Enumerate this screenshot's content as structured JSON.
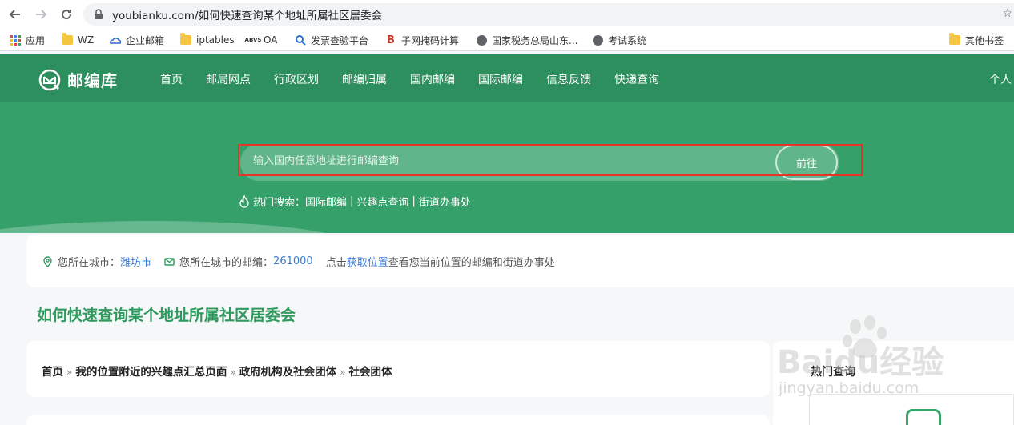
{
  "browser": {
    "url": "youbianku.com/如何快速查询某个地址所属社区居委会",
    "bookmarks": [
      "应用",
      "WZ",
      "企业邮箱",
      "iptables",
      "OA",
      "发票查验平台",
      "子网掩码计算",
      "国家税务总局山东...",
      "考试系统",
      "其他书签"
    ]
  },
  "header": {
    "logo_text": "邮编库",
    "nav": [
      "首页",
      "邮局网点",
      "行政区划",
      "邮编归属",
      "国内邮编",
      "国际邮编",
      "信息反馈",
      "快递查询"
    ],
    "user_link": "个人"
  },
  "hero": {
    "search_placeholder": "输入国内任意地址进行邮编查询",
    "go_label": "前往",
    "hot_label": "热门搜索：",
    "hot_links": [
      "国际邮编",
      "兴趣点查询",
      "街道办事处"
    ],
    "sep": "|"
  },
  "location": {
    "city_label": "您所在城市：",
    "city": "潍坊市",
    "zip_label": "您所在城市的邮编：",
    "zip": "261000",
    "click_text": "点击",
    "get_location": "获取位置",
    "tail_text": "查看您当前位置的邮编和街道办事处"
  },
  "page": {
    "title": "如何快速查询某个地址所属社区居委会",
    "breadcrumb": [
      "首页",
      "我的位置附近的兴趣点汇总页面",
      "政府机构及社会团体",
      "社会团体"
    ],
    "arrow": "»"
  },
  "side": {
    "title": "热门查询"
  },
  "watermark": {
    "brand": "Baidu经验",
    "domain": "jingyan.baidu.com"
  },
  "colors": {
    "header": "#2e8f5e",
    "hero": "#35a06a",
    "title_green": "#2e9a5e",
    "link_blue": "#3a7dd6",
    "highlight": "#e8322c"
  }
}
